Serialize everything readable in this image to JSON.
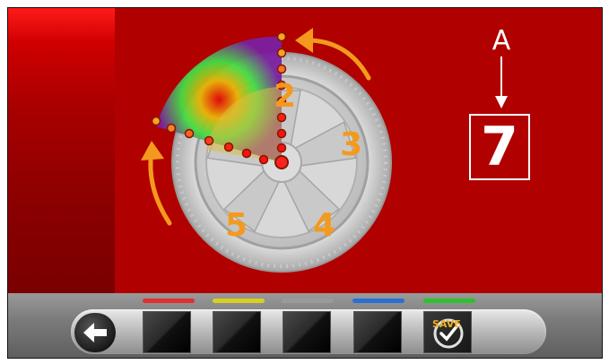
{
  "diagram": {
    "label_a": "A",
    "value": "7",
    "spoke_numbers": [
      "2",
      "3",
      "4",
      "5"
    ]
  },
  "toolbar": {
    "back_icon": "arrow-left-icon",
    "save_icon": "save-check-icon",
    "save_label": "SAVE",
    "leds": [
      "#e23030",
      "#d8d020",
      "#9a9a9a",
      "#2a6fd6",
      "#2fbf2f"
    ]
  },
  "colors": {
    "panel": "#b10000",
    "accent": "#f39a1e"
  }
}
